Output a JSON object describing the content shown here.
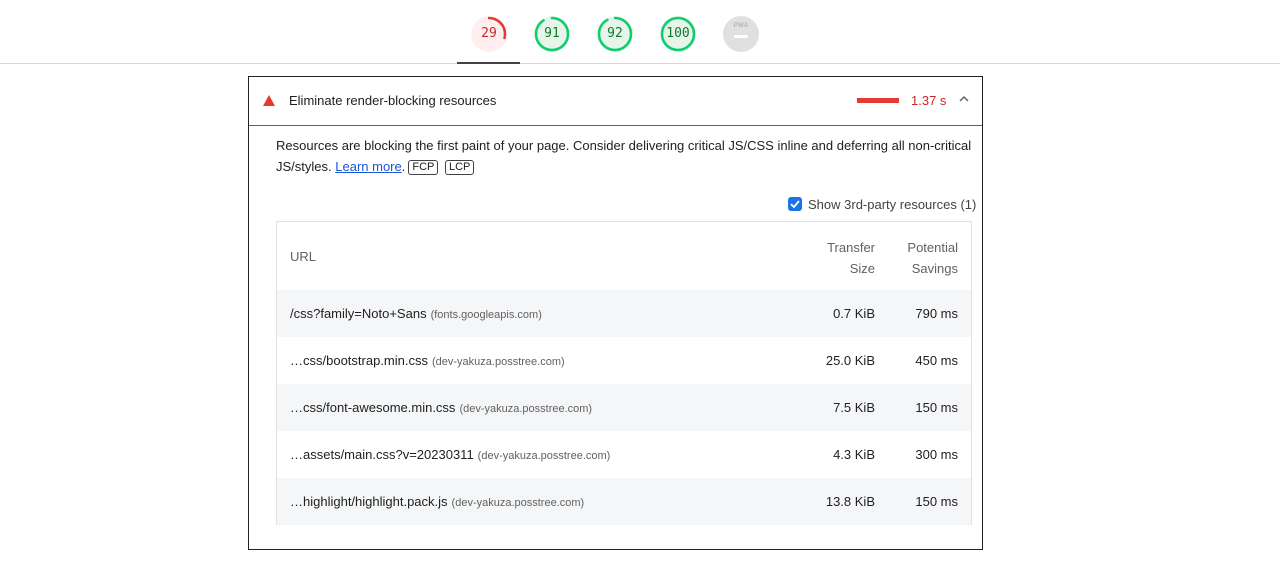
{
  "gauges": [
    {
      "name": "gauge-performance",
      "value": "29",
      "status": "fail",
      "fraction": 0.29,
      "color": "#e53935"
    },
    {
      "name": "gauge-accessibility",
      "value": "91",
      "status": "pass",
      "fraction": 0.91,
      "color": "#0cce6b"
    },
    {
      "name": "gauge-best-practices",
      "value": "92",
      "status": "pass",
      "fraction": 0.92,
      "color": "#0cce6b"
    },
    {
      "name": "gauge-seo",
      "value": "100",
      "status": "pass",
      "fraction": 1.0,
      "color": "#0cce6b"
    },
    {
      "name": "gauge-pwa",
      "label": "PWA",
      "status": "na"
    }
  ],
  "audit": {
    "icon": "warning-triangle-icon",
    "title": "Eliminate render-blocking resources",
    "savings": "1.37 s",
    "expanded": true,
    "description": "Resources are blocking the first paint of your page. Consider delivering critical JS/CSS inline and deferring all non-critical JS/styles.",
    "learn_more": "Learn more",
    "tags": [
      "FCP",
      "LCP"
    ],
    "third_party_label": "Show 3rd-party resources (1)",
    "third_party_checked": true
  },
  "table": {
    "headers": {
      "url": "URL",
      "size_line1": "Transfer",
      "size_line2": "Size",
      "savings_line1": "Potential",
      "savings_line2": "Savings"
    },
    "rows": [
      {
        "url": "/css?family=Noto+Sans",
        "host": "(fonts.googleapis.com)",
        "size": "0.7 KiB",
        "savings": "790 ms"
      },
      {
        "url": "…css/bootstrap.min.css",
        "host": "(dev-yakuza.posstree.com)",
        "size": "25.0 KiB",
        "savings": "450 ms"
      },
      {
        "url": "…css/font-awesome.min.css",
        "host": "(dev-yakuza.posstree.com)",
        "size": "7.5 KiB",
        "savings": "150 ms"
      },
      {
        "url": "…assets/main.css?v=20230311",
        "host": "(dev-yakuza.posstree.com)",
        "size": "4.3 KiB",
        "savings": "300 ms"
      },
      {
        "url": "…highlight/highlight.pack.js",
        "host": "(dev-yakuza.posstree.com)",
        "size": "13.8 KiB",
        "savings": "150 ms"
      }
    ]
  }
}
